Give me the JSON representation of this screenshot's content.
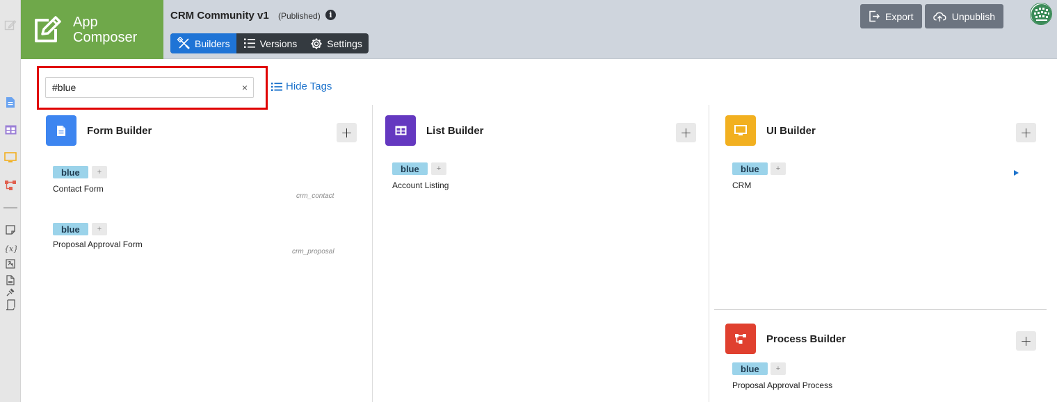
{
  "header": {
    "logo_text": "App Composer",
    "app_title": "CRM Community v1",
    "app_status": "(Published)",
    "info_glyph": "i",
    "tabs": [
      {
        "label": "Builders",
        "icon": "builders-icon",
        "active": true
      },
      {
        "label": "Versions",
        "icon": "list-icon",
        "active": false
      },
      {
        "label": "Settings",
        "icon": "gear-icon",
        "active": false
      }
    ],
    "export_label": "Export",
    "unpublish_label": "Unpublish"
  },
  "search": {
    "value": "#blue",
    "clear_glyph": "×",
    "hide_tags_label": "Hide Tags"
  },
  "builders": {
    "form": {
      "title": "Form Builder",
      "color": "#3d85f0",
      "add_glyph": "+",
      "items": [
        {
          "tag": "blue",
          "tag_add": "+",
          "name": "Contact Form",
          "id": "crm_contact"
        },
        {
          "tag": "blue",
          "tag_add": "+",
          "name": "Proposal Approval Form",
          "id": "crm_proposal"
        }
      ]
    },
    "list": {
      "title": "List Builder",
      "color": "#6438c0",
      "add_glyph": "+",
      "items": [
        {
          "tag": "blue",
          "tag_add": "+",
          "name": "Account Listing"
        }
      ]
    },
    "ui": {
      "title": "UI Builder",
      "color": "#f2b020",
      "add_glyph": "+",
      "items": [
        {
          "tag": "blue",
          "tag_add": "+",
          "name": "CRM"
        }
      ]
    },
    "process": {
      "title": "Process Builder",
      "color": "#e0402f",
      "add_glyph": "+",
      "items": [
        {
          "tag": "blue",
          "tag_add": "+",
          "name": "Proposal Approval Process"
        }
      ]
    }
  },
  "colors": {
    "header_bg": "#cfd5dd",
    "logo_bg": "#6fa84a",
    "tab_active": "#1f74d6",
    "tag_bg": "#9bd3ea",
    "highlight": "#e00000",
    "link": "#1d73cc"
  }
}
